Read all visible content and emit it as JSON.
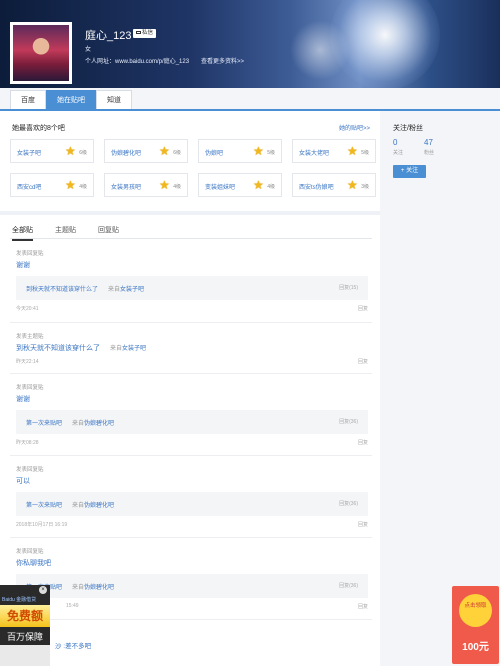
{
  "profile": {
    "username": "庭心_123",
    "message_label": "私信",
    "gender": "女",
    "site_label": "个人网址：www.baidu.com/p/庭心_123",
    "more_link": "查看更多资料>>"
  },
  "tabs": [
    {
      "label": "百度",
      "active": false
    },
    {
      "label": "她在贴吧",
      "active": true
    },
    {
      "label": "知道",
      "active": false
    }
  ],
  "fav_bars": {
    "title": "她最喜欢的8个吧",
    "link": "她的贴吧>>",
    "items": [
      {
        "name": "女装子吧",
        "level": "6级"
      },
      {
        "name": "伪娘碧化吧",
        "level": "6级"
      },
      {
        "name": "伪娘吧",
        "level": "5级"
      },
      {
        "name": "女装大佬吧",
        "level": "5级"
      },
      {
        "name": "西安cd吧",
        "level": "4级"
      },
      {
        "name": "女装男孩吧",
        "level": "4级"
      },
      {
        "name": "变装姐妹吧",
        "level": "4级"
      },
      {
        "name": "西安ts伪娘吧",
        "level": "3级"
      }
    ]
  },
  "post_tabs": [
    "全部贴",
    "主题贴",
    "回复贴"
  ],
  "posts": [
    {
      "type": "发表回复贴",
      "title": "谢谢",
      "quote_title": "到秋天就不知道该穿什么了",
      "quote_from_prefix": "来自",
      "quote_from": "女装子吧",
      "quote_reply": "回复(15)",
      "time": "今天20:41",
      "reply": "回复"
    },
    {
      "type": "发表主题贴",
      "title": "到秋天就不知道该穿什么了",
      "from_prefix": "来自",
      "from": "女装子吧",
      "time": "昨天22:14",
      "reply": "回复"
    },
    {
      "type": "发表回复贴",
      "title": "谢谢",
      "quote_title": "第一次来贴吧",
      "quote_from_prefix": "来自",
      "quote_from": "伪娘碧化吧",
      "quote_reply": "回复(36)",
      "time": "昨天08:28",
      "reply": "回复"
    },
    {
      "type": "发表回复贴",
      "title": "可以",
      "quote_title": "第一次来贴吧",
      "quote_from_prefix": "来自",
      "quote_from": "伪娘碧化吧",
      "quote_reply": "回复(36)",
      "time": "2018年10月17日 16:19",
      "reply": "回复"
    },
    {
      "type": "发表回复贴",
      "title": "你私聊我吧",
      "quote_title": "第一次来贴吧",
      "quote_from_prefix": "来自",
      "quote_from": "伪娘碧化吧",
      "quote_reply": "回复(36)",
      "time": "15:49",
      "reply": "回复"
    }
  ],
  "peek_text": "沙 :差不多吧",
  "sidebar": {
    "title": "关注/粉丝",
    "following_count": "0",
    "following_label": "关注",
    "fans_count": "47",
    "fans_label": "粉丝",
    "follow_button": "+ 关注"
  },
  "ad_left": {
    "brand": "Baidu 金融借贷",
    "headline": "免费额",
    "subline": "百万保障",
    "close": "×"
  },
  "ad_right": {
    "circle_text": "点击领取",
    "amount": "100元"
  },
  "colors": {
    "accent": "#4a8fd4",
    "link": "#3a75c4",
    "star": "#f2b81a",
    "ad_red": "#f05a4b"
  }
}
